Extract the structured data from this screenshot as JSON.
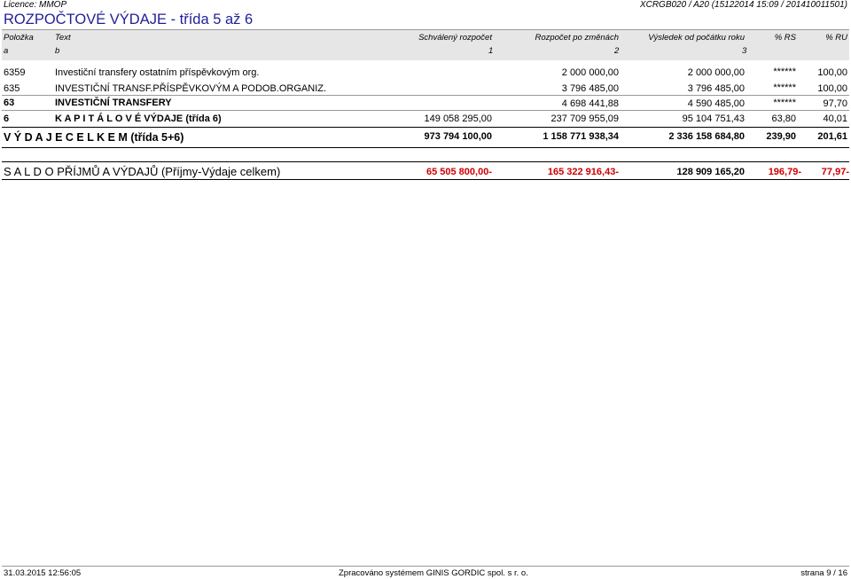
{
  "header": {
    "licence": "Licence: MMOP",
    "report_id": "XCRGB020 / A20  (15122014 15:09 / 201410011501)",
    "title": "ROZPOČTOVÉ VÝDAJE - třída 5 až 6"
  },
  "columns": {
    "polozka": "Položka",
    "text": "Text",
    "schvaleny": "Schválený rozpočet",
    "po_zmenach": "Rozpočet po změnách",
    "vysledek": "Výsledek od počátku roku",
    "pct_rs": "% RS",
    "pct_ru": "% RU",
    "sub_a": "a",
    "sub_b": "b",
    "sub_1": "1",
    "sub_2": "2",
    "sub_3": "3"
  },
  "rows": [
    {
      "code": "6359",
      "text": "Investiční transfery ostatním příspěvkovým org.",
      "schvaleny": "",
      "po_zmenach": "2 000 000,00",
      "vysledek": "2 000 000,00",
      "pct_rs": "******",
      "pct_ru": "100,00"
    },
    {
      "code": "635",
      "text": "INVESTIČNÍ TRANSF.PŘÍSPĚVKOVÝM A PODOB.ORGANIZ.",
      "schvaleny": "",
      "po_zmenach": "3 796 485,00",
      "vysledek": "3 796 485,00",
      "pct_rs": "******",
      "pct_ru": "100,00"
    },
    {
      "code": "63",
      "text": "INVESTIČNÍ TRANSFERY",
      "schvaleny": "",
      "po_zmenach": "4 698 441,88",
      "vysledek": "4 590 485,00",
      "pct_rs": "******",
      "pct_ru": "97,70"
    },
    {
      "code": "6",
      "text": "K A P I T Á L O V É  VÝDAJE (třída 6)",
      "schvaleny": "149 058 295,00",
      "po_zmenach": "237 709 955,09",
      "vysledek": "95 104 751,43",
      "pct_rs": "63,80",
      "pct_ru": "40,01"
    }
  ],
  "total": {
    "text": "V Ý D A J E  C E L K E M  (třída 5+6)",
    "schvaleny": "973 794 100,00",
    "po_zmenach": "1 158 771 938,34",
    "vysledek": "2 336 158 684,80",
    "pct_rs": "239,90",
    "pct_ru": "201,61"
  },
  "saldo": {
    "text": "S A L D O  PŘÍJMŮ A VÝDAJŮ (Příjmy-Výdaje celkem)",
    "schvaleny": "65 505 800,00-",
    "po_zmenach": "165 322 916,43-",
    "vysledek": "128 909 165,20",
    "pct_rs": "196,79-",
    "pct_ru": "77,97-"
  },
  "footer": {
    "datetime": "31.03.2015 12:56:05",
    "processed": "Zpracováno systémem  GINIS GORDIC spol. s  r. o.",
    "page": "strana 9 / 16"
  },
  "colors": {
    "title": "#1f1f96",
    "saldo_negative": "#cc0000",
    "header_band": "#e6e6e6"
  }
}
